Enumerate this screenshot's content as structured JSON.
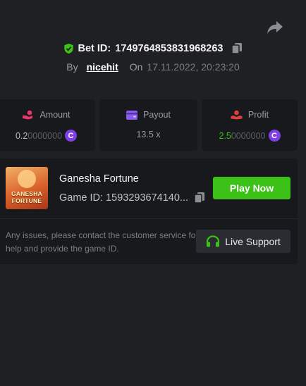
{
  "bet": {
    "id_label": "Bet ID:",
    "id_value": "1749764853831968263",
    "by_label": "By",
    "username": "nicehit",
    "on_label": "On",
    "date": "17.11.2022, 20:23:20"
  },
  "stats": {
    "amount": {
      "label": "Amount",
      "value_bright": "0.2",
      "value_dim": "0000000",
      "icon": "coins-hand-icon",
      "icon_color": "#e8376c"
    },
    "payout": {
      "label": "Payout",
      "value": "13.5 x",
      "icon": "wallet-icon",
      "icon_color": "#8c5cf0"
    },
    "profit": {
      "label": "Profit",
      "value_bright": "2.5",
      "value_dim": "0000000",
      "icon": "money-hand-icon",
      "icon_color": "#e0403a"
    },
    "coin_symbol": "C"
  },
  "game": {
    "name": "Ganesha Fortune",
    "id_label": "Game ID:",
    "id_value": "1593293674140...",
    "thumb_line1": "GANESHA",
    "thumb_line2": "FORTUNE",
    "play_label": "Play Now"
  },
  "support": {
    "help_text": "Any issues, please contact the customer service for help and provide the game ID.",
    "button_label": "Live Support"
  },
  "colors": {
    "background": "#1f2023",
    "panel": "#18191c",
    "accent_green": "#3bc117",
    "coin_purple": "#7e3fe6"
  }
}
